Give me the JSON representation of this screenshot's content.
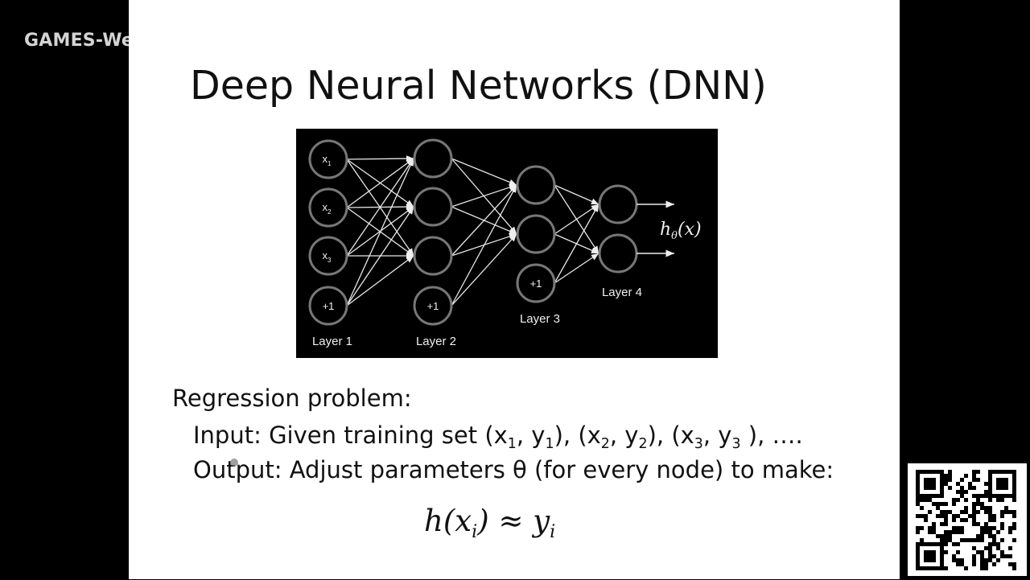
{
  "overlay": {
    "channel_label": "GAMES-Webinar"
  },
  "slide": {
    "title": "Deep Neural Networks (DNN)",
    "diagram": {
      "nodes": {
        "x1": "x",
        "x1_sub": "1",
        "x2": "x",
        "x2_sub": "2",
        "x3": "x",
        "x3_sub": "3",
        "bias_l1": "+1",
        "bias_l2": "+1",
        "bias_l3": "+1"
      },
      "layer_labels": [
        "Layer 1",
        "Layer 2",
        "Layer 3",
        "Layer 4"
      ],
      "output_label": "hθ(x)",
      "output_label_base": "h",
      "output_label_sub": "θ",
      "output_label_arg": "(x)"
    },
    "regression_heading": "Regression problem:",
    "input_line": {
      "prefix": "Input: Given training set (x",
      "s1": "1",
      "m1": ", y",
      "s2": "1",
      "m2": "), (x",
      "s3": "2",
      "m3": ", y",
      "s4": "2",
      "m4": "), (x",
      "s5": "3",
      "m5": ", y",
      "s6": "3",
      "suffix": " ), …."
    },
    "output_line": "Output: Adjust parameters θ (for every node) to make:",
    "formula": {
      "left": "h(x",
      "sub1": "i",
      "mid": ") ≈ y",
      "sub2": "i"
    }
  }
}
